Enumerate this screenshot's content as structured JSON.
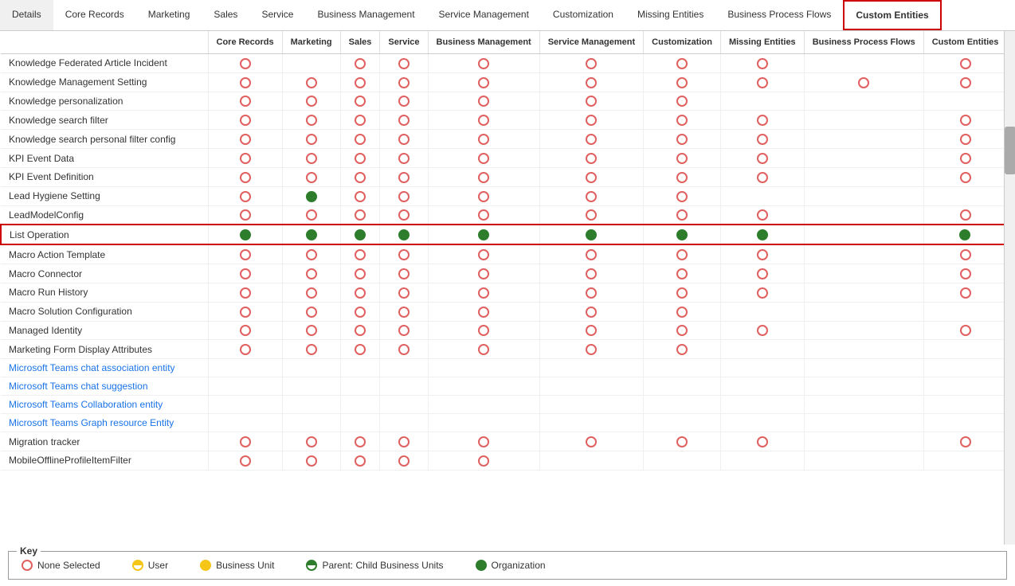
{
  "tabs": [
    {
      "id": "details",
      "label": "Details",
      "active": false
    },
    {
      "id": "core-records",
      "label": "Core Records",
      "active": false
    },
    {
      "id": "marketing",
      "label": "Marketing",
      "active": false
    },
    {
      "id": "sales",
      "label": "Sales",
      "active": false
    },
    {
      "id": "service",
      "label": "Service",
      "active": false
    },
    {
      "id": "business-mgmt",
      "label": "Business Management",
      "active": false
    },
    {
      "id": "service-mgmt",
      "label": "Service Management",
      "active": false
    },
    {
      "id": "customization",
      "label": "Customization",
      "active": false
    },
    {
      "id": "missing-entities",
      "label": "Missing Entities",
      "active": false
    },
    {
      "id": "bpf",
      "label": "Business Process Flows",
      "active": false
    },
    {
      "id": "custom-entities",
      "label": "Custom Entities",
      "active": true,
      "highlighted": true
    }
  ],
  "columns": [
    {
      "id": "name",
      "label": ""
    },
    {
      "id": "core",
      "label": "Core Records"
    },
    {
      "id": "marketing",
      "label": "Marketing"
    },
    {
      "id": "sales",
      "label": "Sales"
    },
    {
      "id": "service",
      "label": "Service"
    },
    {
      "id": "biz-mgmt",
      "label": "Business Management"
    },
    {
      "id": "service-mgmt",
      "label": "Service Management"
    },
    {
      "id": "customization",
      "label": "Customization"
    },
    {
      "id": "missing",
      "label": "Missing Entities"
    },
    {
      "id": "bpf",
      "label": "Business Process Flows"
    },
    {
      "id": "custom",
      "label": "Custom Entities"
    }
  ],
  "rows": [
    {
      "name": "Knowledge Federated Article Incident",
      "link": false,
      "cells": [
        "empty",
        "",
        "empty",
        "empty",
        "empty",
        "empty",
        "empty",
        "empty",
        "",
        "empty"
      ]
    },
    {
      "name": "Knowledge Management Setting",
      "link": false,
      "cells": [
        "empty",
        "empty",
        "empty",
        "empty",
        "empty",
        "empty",
        "empty",
        "empty",
        "empty",
        "empty"
      ]
    },
    {
      "name": "Knowledge personalization",
      "link": false,
      "cells": [
        "empty",
        "empty",
        "empty",
        "empty",
        "empty",
        "empty",
        "empty",
        "",
        "",
        ""
      ]
    },
    {
      "name": "Knowledge search filter",
      "link": false,
      "cells": [
        "empty",
        "empty",
        "empty",
        "empty",
        "empty",
        "empty",
        "empty",
        "empty",
        "",
        "empty"
      ]
    },
    {
      "name": "Knowledge search personal filter config",
      "link": false,
      "cells": [
        "empty",
        "empty",
        "empty",
        "empty",
        "empty",
        "empty",
        "empty",
        "empty",
        "",
        "empty"
      ]
    },
    {
      "name": "KPI Event Data",
      "link": false,
      "cells": [
        "empty",
        "empty",
        "empty",
        "empty",
        "empty",
        "empty",
        "empty",
        "empty",
        "",
        "empty"
      ]
    },
    {
      "name": "KPI Event Definition",
      "link": false,
      "cells": [
        "empty",
        "empty",
        "empty",
        "empty",
        "empty",
        "empty",
        "empty",
        "empty",
        "",
        "empty"
      ]
    },
    {
      "name": "Lead Hygiene Setting",
      "link": false,
      "cells": [
        "empty",
        "green-full",
        "empty",
        "empty",
        "empty",
        "empty",
        "empty",
        "",
        "",
        ""
      ]
    },
    {
      "name": "LeadModelConfig",
      "link": false,
      "cells": [
        "empty",
        "empty",
        "empty",
        "empty",
        "empty",
        "empty",
        "empty",
        "empty",
        "",
        "empty"
      ]
    },
    {
      "name": "List Operation",
      "link": false,
      "highlighted": true,
      "cells": [
        "green-full",
        "green-full",
        "green-full",
        "green-full",
        "green-full",
        "green-full",
        "green-full",
        "green-full",
        "",
        "green-full"
      ]
    },
    {
      "name": "Macro Action Template",
      "link": false,
      "cells": [
        "empty",
        "empty",
        "empty",
        "empty",
        "empty",
        "empty",
        "empty",
        "empty",
        "",
        "empty"
      ]
    },
    {
      "name": "Macro Connector",
      "link": false,
      "cells": [
        "empty",
        "empty",
        "empty",
        "empty",
        "empty",
        "empty",
        "empty",
        "empty",
        "",
        "empty"
      ]
    },
    {
      "name": "Macro Run History",
      "link": false,
      "cells": [
        "empty",
        "empty",
        "empty",
        "empty",
        "empty",
        "empty",
        "empty",
        "empty",
        "",
        "empty"
      ]
    },
    {
      "name": "Macro Solution Configuration",
      "link": false,
      "cells": [
        "empty",
        "empty",
        "empty",
        "empty",
        "empty",
        "empty",
        "empty",
        "",
        "",
        ""
      ]
    },
    {
      "name": "Managed Identity",
      "link": false,
      "cells": [
        "empty",
        "empty",
        "empty",
        "empty",
        "empty",
        "empty",
        "empty",
        "empty",
        "",
        "empty"
      ]
    },
    {
      "name": "Marketing Form Display Attributes",
      "link": false,
      "cells": [
        "empty",
        "empty",
        "empty",
        "empty",
        "empty",
        "empty",
        "empty",
        "",
        "",
        ""
      ]
    },
    {
      "name": "Microsoft Teams chat association entity",
      "link": true,
      "cells": [
        "",
        "",
        "",
        "",
        "",
        "",
        "",
        "",
        "",
        ""
      ]
    },
    {
      "name": "Microsoft Teams chat suggestion",
      "link": true,
      "cells": [
        "",
        "",
        "",
        "",
        "",
        "",
        "",
        "",
        "",
        ""
      ]
    },
    {
      "name": "Microsoft Teams Collaboration entity",
      "link": true,
      "cells": [
        "",
        "",
        "",
        "",
        "",
        "",
        "",
        "",
        "",
        ""
      ]
    },
    {
      "name": "Microsoft Teams Graph resource Entity",
      "link": true,
      "cells": [
        "",
        "",
        "",
        "",
        "",
        "",
        "",
        "",
        "",
        ""
      ]
    },
    {
      "name": "Migration tracker",
      "link": false,
      "cells": [
        "empty",
        "empty",
        "empty",
        "empty",
        "empty",
        "empty",
        "empty",
        "empty",
        "",
        "empty"
      ]
    },
    {
      "name": "MobileOfflineProfileItemFilter",
      "link": false,
      "cells": [
        "empty",
        "empty",
        "empty",
        "empty",
        "empty",
        "",
        "",
        "",
        "",
        ""
      ]
    }
  ],
  "key": {
    "title": "Key",
    "items": [
      {
        "type": "circle-empty",
        "label": "None Selected"
      },
      {
        "type": "circle-yellow-half",
        "label": "User"
      },
      {
        "type": "circle-yellow-full",
        "label": "Business Unit"
      },
      {
        "type": "circle-green-half",
        "label": "Parent: Child Business Units"
      },
      {
        "type": "circle-green-full",
        "label": "Organization"
      }
    ]
  }
}
